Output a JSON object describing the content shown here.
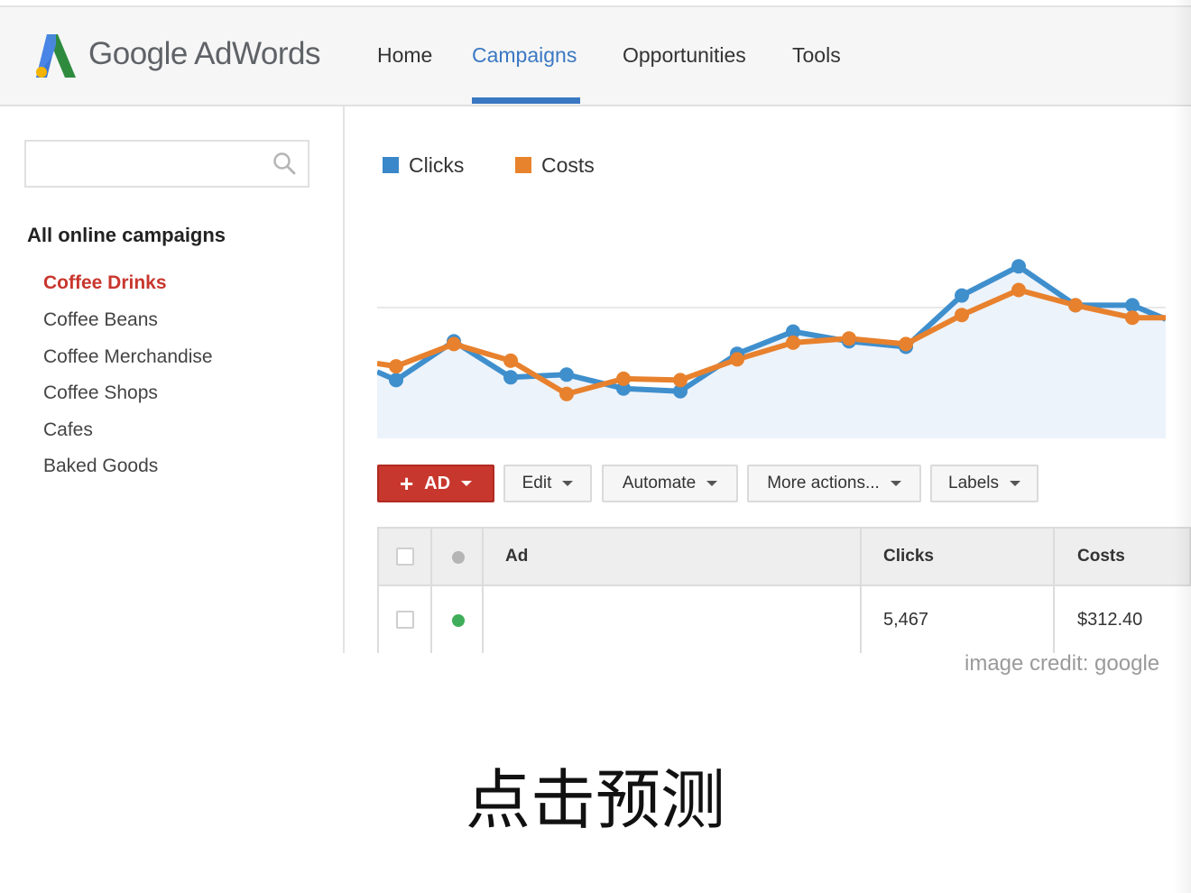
{
  "header": {
    "logo_text": "Google AdWords",
    "logo_icon": "adwords-logo-icon",
    "nav": [
      {
        "label": "Home",
        "active": false
      },
      {
        "label": "Campaigns",
        "active": true
      },
      {
        "label": "Opportunities",
        "active": false
      },
      {
        "label": "Tools",
        "active": false
      }
    ]
  },
  "sidebar": {
    "search": {
      "placeholder": "",
      "value": "",
      "icon": "search-icon"
    },
    "heading": "All online campaigns",
    "items": [
      {
        "label": "Coffee Drinks",
        "active": true
      },
      {
        "label": "Coffee Beans",
        "active": false
      },
      {
        "label": "Coffee Merchandise",
        "active": false
      },
      {
        "label": "Coffee Shops",
        "active": false
      },
      {
        "label": "Cafes",
        "active": false
      },
      {
        "label": "Baked Goods",
        "active": false
      }
    ]
  },
  "chart_data": {
    "type": "line",
    "title": "",
    "xlabel": "",
    "ylabel": "",
    "grid": false,
    "legend_position": "top-left",
    "x": [
      0,
      1,
      2,
      3,
      4,
      5,
      6,
      7,
      8,
      9,
      10,
      11,
      12,
      13,
      14,
      15
    ],
    "series": [
      {
        "name": "Clicks",
        "color": "#3f8fcd",
        "fill": "#edf3fb",
        "values": [
          48,
          42,
          70,
          44,
          46,
          36,
          34,
          61,
          77,
          70,
          66,
          103,
          124,
          96,
          96,
          86
        ]
      },
      {
        "name": "Costs",
        "color": "#e8812d",
        "values": [
          54,
          52,
          68,
          56,
          32,
          43,
          42,
          57,
          69,
          72,
          68,
          89,
          107,
          96,
          87,
          87
        ]
      }
    ],
    "ylim": [
      0,
      160
    ]
  },
  "legend": [
    {
      "label": "Clicks",
      "color": "#3a87c9"
    },
    {
      "label": "Costs",
      "color": "#e8832d"
    }
  ],
  "toolbar": {
    "ad_label": "AD",
    "edit_label": "Edit",
    "automate_label": "Automate",
    "more_label": "More actions...",
    "labels_label": "Labels"
  },
  "table": {
    "columns": [
      "Ad",
      "Clicks",
      "Costs"
    ],
    "rows": [
      {
        "status_color": "#3fae5a",
        "ad": "",
        "clicks": "5,467",
        "costs": "$312.40"
      }
    ],
    "header_status_color": "#b5b5b5"
  },
  "credit": "image credit: google",
  "subtitle": "点击预测",
  "colors": {
    "accent": "#3a78c3",
    "active_item": "#c8372d",
    "primary_button": "#c8372d"
  }
}
